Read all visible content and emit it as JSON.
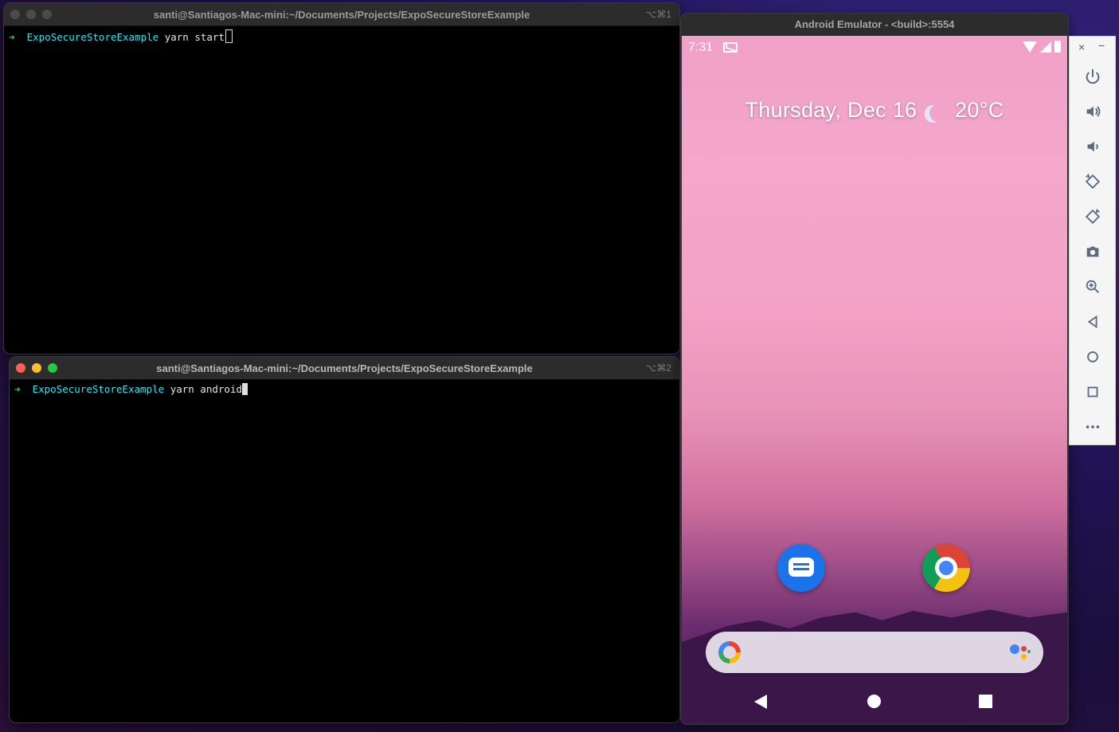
{
  "terminal1": {
    "title": "santi@Santiagos-Mac-mini:~/Documents/Projects/ExpoSecureStoreExample",
    "shortcut": "⌥⌘1",
    "prompt_arrow": "➜",
    "prompt_dir": "ExpoSecureStoreExample",
    "command": " yarn start"
  },
  "terminal2": {
    "title": "santi@Santiagos-Mac-mini:~/Documents/Projects/ExpoSecureStoreExample",
    "shortcut": "⌥⌘2",
    "prompt_arrow": "➜",
    "prompt_dir": "ExpoSecureStoreExample",
    "command": " yarn android"
  },
  "emulator": {
    "title": "Android Emulator - <build>:5554",
    "status_time": "7:31",
    "date_text": "Thursday, Dec 16",
    "temperature": "20°C",
    "apps": [
      "messages-icon",
      "chrome-icon"
    ],
    "nav": [
      "back",
      "home",
      "recents"
    ]
  },
  "toolbar": {
    "close": "×",
    "minimize": "−",
    "buttons": [
      "power",
      "volume-up",
      "volume-down",
      "rotate-left",
      "rotate-right",
      "camera",
      "zoom",
      "back",
      "home",
      "overview",
      "more"
    ]
  },
  "colors": {
    "prompt_arrow": "#2fd36b",
    "prompt_dir": "#35e3f5",
    "close_light": "#ff5f57",
    "min_light": "#febc2e",
    "max_light": "#28c840"
  }
}
